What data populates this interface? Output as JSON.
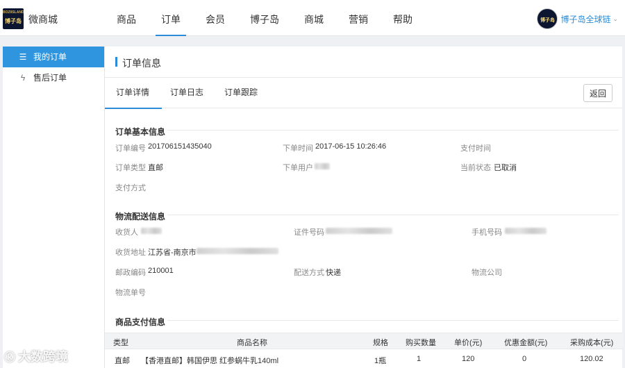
{
  "header": {
    "logo_brand_top": "BOZIISLAND",
    "logo_brand": "博子岛",
    "app_name": "微商城",
    "nav": [
      "商品",
      "订单",
      "会员",
      "博子岛",
      "商城",
      "营销",
      "帮助"
    ],
    "active_nav": "订单",
    "user_name": "博子岛全球链",
    "user_chevron": "⌄"
  },
  "sidebar": {
    "items": [
      {
        "label": "我的订单",
        "icon": "list-icon",
        "active": true
      },
      {
        "label": "售后订单",
        "icon": "lightning-icon",
        "active": false
      }
    ]
  },
  "panel": {
    "title": "订单信息",
    "tabs": [
      "订单详情",
      "订单日志",
      "订单跟踪"
    ],
    "back_label": "返回"
  },
  "basic": {
    "title": "订单基本信息",
    "order_no_label": "订单编号",
    "order_no": "201706151435040",
    "order_time_label": "下单时间",
    "order_time": "2017-06-15 10:26:46",
    "pay_time_label": "支付时间",
    "pay_time": "",
    "order_type_label": "订单类型",
    "order_type": "直邮",
    "order_user_label": "下单用户",
    "status_label": "当前状态",
    "status": "已取消",
    "pay_method_label": "支付方式",
    "pay_method": ""
  },
  "logistics": {
    "title": "物流配送信息",
    "receiver_label": "收货人",
    "id_no_label": "证件号码",
    "phone_label": "手机号码",
    "address_label": "收货地址",
    "address_prefix": "江苏省-南京市",
    "postcode_label": "邮政编码",
    "postcode": "210001",
    "delivery_label": "配送方式",
    "delivery": "快递",
    "company_label": "物流公司",
    "company": "",
    "tracking_label": "物流单号",
    "tracking": ""
  },
  "payment": {
    "title": "商品支付信息",
    "columns": [
      "类型",
      "商品名称",
      "规格",
      "购买数量",
      "单价(元)",
      "优惠金额(元)",
      "采购成本(元)"
    ],
    "rows": [
      {
        "type": "直邮",
        "name": "【香港直邮】韩国伊思 红参蜗牛乳140ml",
        "spec": "1瓶",
        "qty": "1",
        "price": "120",
        "discount": "0",
        "cost": "120.02"
      }
    ]
  },
  "watermark": {
    "text": "大数跨境",
    "icon": "ka-icon"
  }
}
